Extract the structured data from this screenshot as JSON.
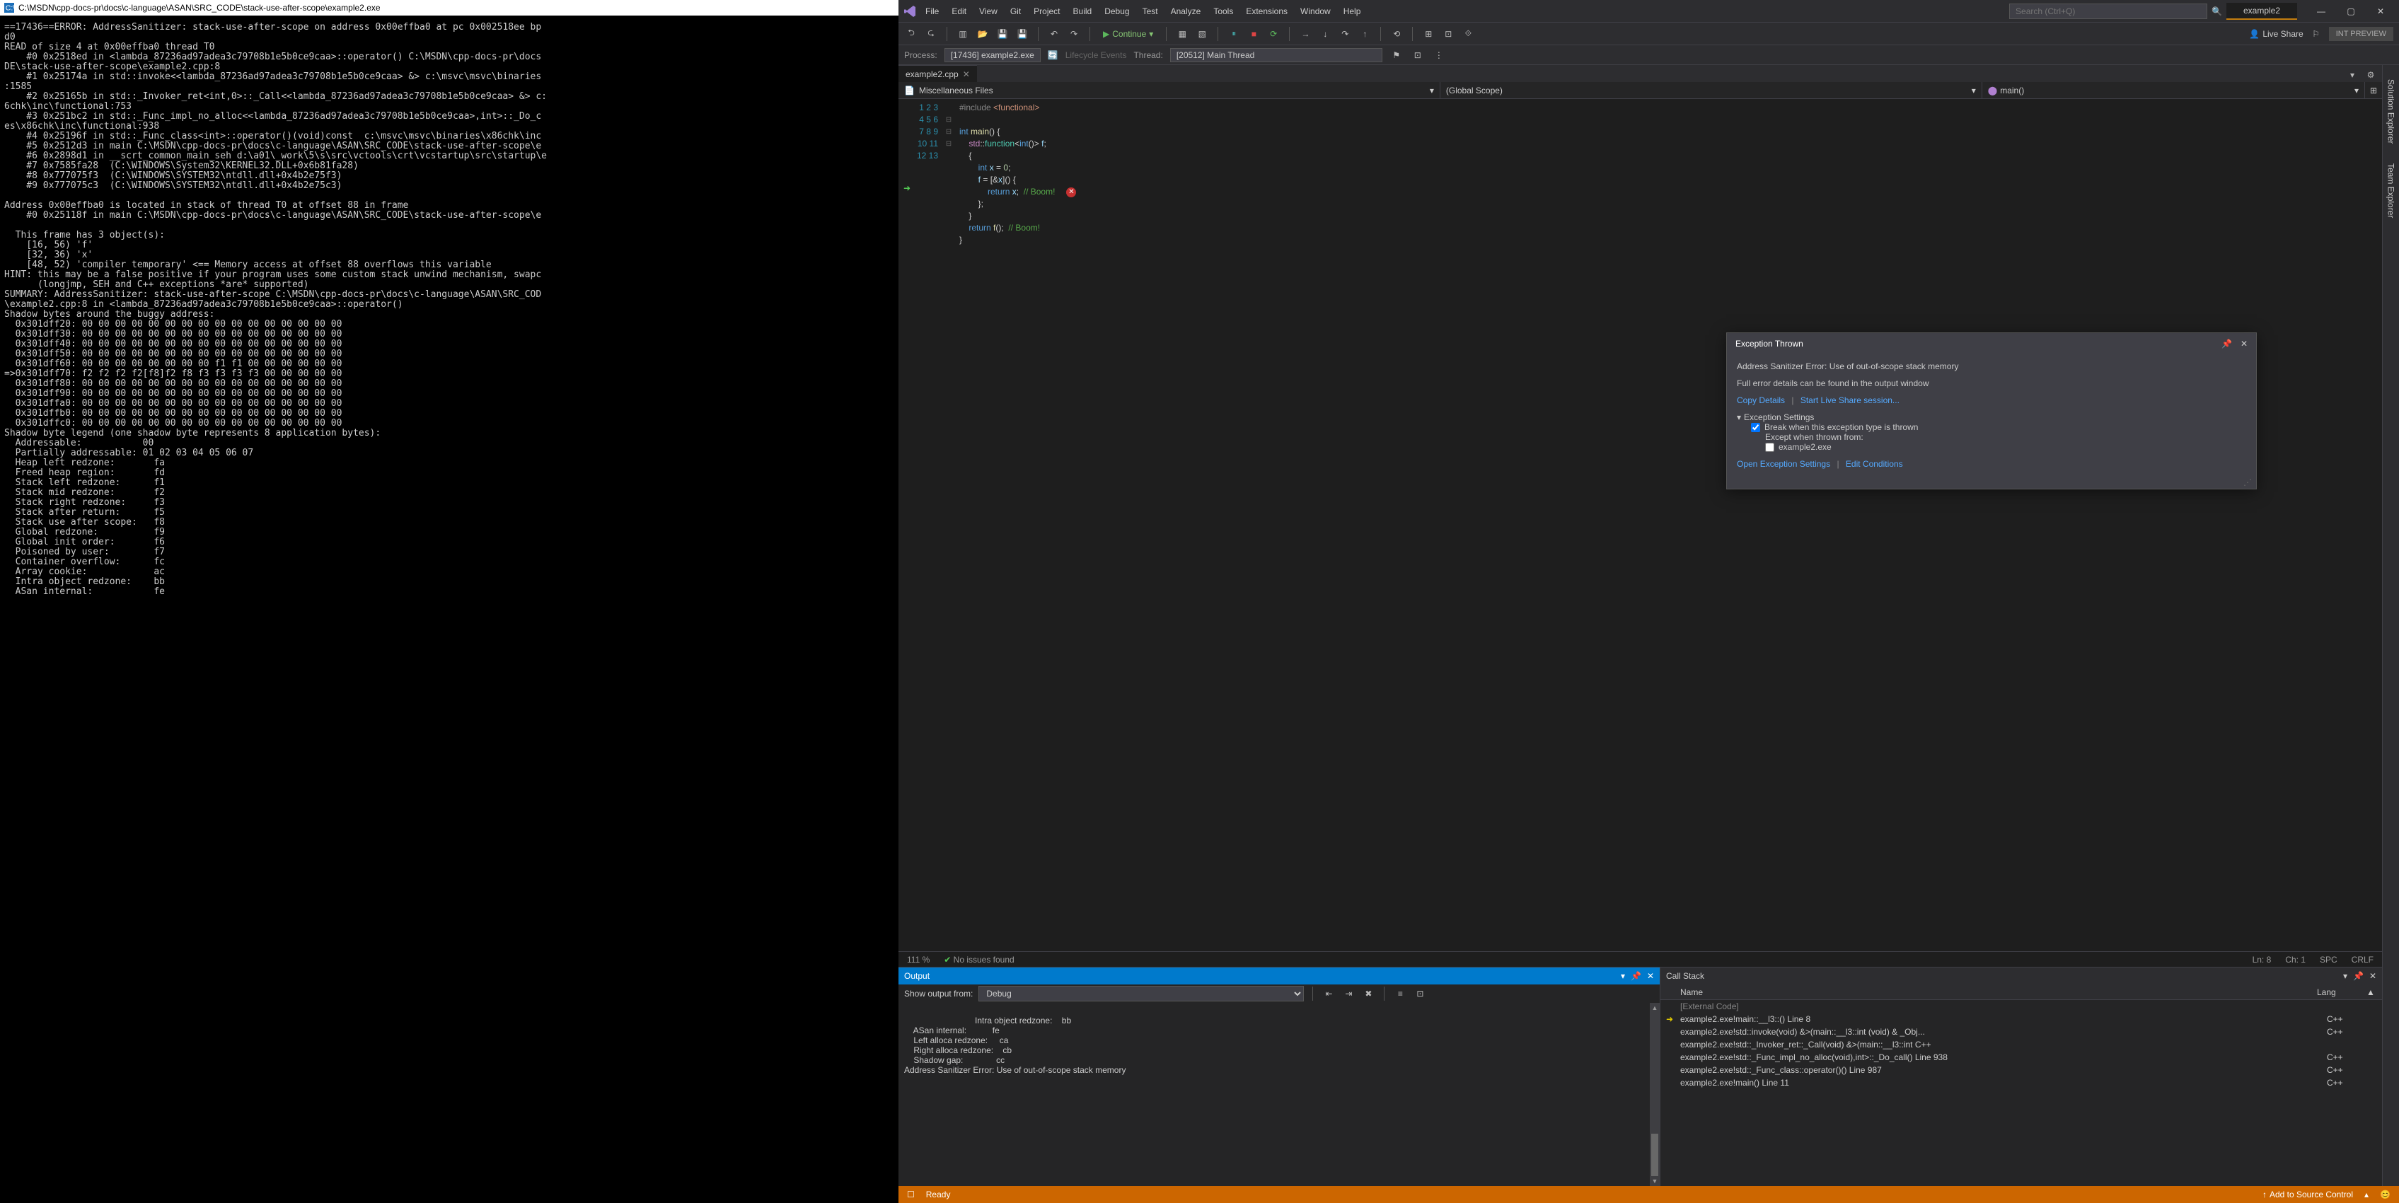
{
  "console": {
    "title": "C:\\MSDN\\cpp-docs-pr\\docs\\c-language\\ASAN\\SRC_CODE\\stack-use-after-scope\\example2.exe",
    "body": "==17436==ERROR: AddressSanitizer: stack-use-after-scope on address 0x00effba0 at pc 0x002518ee bp\nd0\nREAD of size 4 at 0x00effba0 thread T0\n    #0 0x2518ed in <lambda_87236ad97adea3c79708b1e5b0ce9caa>::operator() C:\\MSDN\\cpp-docs-pr\\docs\nDE\\stack-use-after-scope\\example2.cpp:8\n    #1 0x25174a in std::invoke<<lambda_87236ad97adea3c79708b1e5b0ce9caa> &> c:\\msvc\\msvc\\binaries\n:1585\n    #2 0x25165b in std::_Invoker_ret<int,0>::_Call<<lambda_87236ad97adea3c79708b1e5b0ce9caa> &> c:\n6chk\\inc\\functional:753\n    #3 0x251bc2 in std::_Func_impl_no_alloc<<lambda_87236ad97adea3c79708b1e5b0ce9caa>,int>::_Do_c\nes\\x86chk\\inc\\functional:938\n    #4 0x25196f in std::_Func_class<int>::operator()(void)const  c:\\msvc\\msvc\\binaries\\x86chk\\inc\n    #5 0x2512d3 in main C:\\MSDN\\cpp-docs-pr\\docs\\c-language\\ASAN\\SRC_CODE\\stack-use-after-scope\\e\n    #6 0x2898d1 in __scrt_common_main_seh d:\\a01\\_work\\5\\s\\src\\vctools\\crt\\vcstartup\\src\\startup\\e\n    #7 0x7585fa28  (C:\\WINDOWS\\System32\\KERNEL32.DLL+0x6b81fa28)\n    #8 0x777075f3  (C:\\WINDOWS\\SYSTEM32\\ntdll.dll+0x4b2e75f3)\n    #9 0x777075c3  (C:\\WINDOWS\\SYSTEM32\\ntdll.dll+0x4b2e75c3)\n\nAddress 0x00effba0 is located in stack of thread T0 at offset 88 in frame\n    #0 0x25118f in main C:\\MSDN\\cpp-docs-pr\\docs\\c-language\\ASAN\\SRC_CODE\\stack-use-after-scope\\e\n\n  This frame has 3 object(s):\n    [16, 56) 'f'\n    [32, 36) 'x'\n    [48, 52) 'compiler temporary' <== Memory access at offset 88 overflows this variable\nHINT: this may be a false positive if your program uses some custom stack unwind mechanism, swapc\n      (longjmp, SEH and C++ exceptions *are* supported)\nSUMMARY: AddressSanitizer: stack-use-after-scope C:\\MSDN\\cpp-docs-pr\\docs\\c-language\\ASAN\\SRC_COD\n\\example2.cpp:8 in <lambda_87236ad97adea3c79708b1e5b0ce9caa>::operator()\nShadow bytes around the buggy address:\n  0x301dff20: 00 00 00 00 00 00 00 00 00 00 00 00 00 00 00 00\n  0x301dff30: 00 00 00 00 00 00 00 00 00 00 00 00 00 00 00 00\n  0x301dff40: 00 00 00 00 00 00 00 00 00 00 00 00 00 00 00 00\n  0x301dff50: 00 00 00 00 00 00 00 00 00 00 00 00 00 00 00 00\n  0x301dff60: 00 00 00 00 00 00 00 00 f1 f1 00 00 00 00 00 00\n=>0x301dff70: f2 f2 f2 f2[f8]f2 f8 f3 f3 f3 f3 00 00 00 00 00\n  0x301dff80: 00 00 00 00 00 00 00 00 00 00 00 00 00 00 00 00\n  0x301dff90: 00 00 00 00 00 00 00 00 00 00 00 00 00 00 00 00\n  0x301dffa0: 00 00 00 00 00 00 00 00 00 00 00 00 00 00 00 00\n  0x301dffb0: 00 00 00 00 00 00 00 00 00 00 00 00 00 00 00 00\n  0x301dffc0: 00 00 00 00 00 00 00 00 00 00 00 00 00 00 00 00\nShadow byte legend (one shadow byte represents 8 application bytes):\n  Addressable:           00\n  Partially addressable: 01 02 03 04 05 06 07\n  Heap left redzone:       fa\n  Freed heap region:       fd\n  Stack left redzone:      f1\n  Stack mid redzone:       f2\n  Stack right redzone:     f3\n  Stack after return:      f5\n  Stack use after scope:   f8\n  Global redzone:          f9\n  Global init order:       f6\n  Poisoned by user:        f7\n  Container overflow:      fc\n  Array cookie:            ac\n  Intra object redzone:    bb\n  ASan internal:           fe"
  },
  "vs": {
    "menu": [
      "File",
      "Edit",
      "View",
      "Git",
      "Project",
      "Build",
      "Debug",
      "Test",
      "Analyze",
      "Tools",
      "Extensions",
      "Window",
      "Help"
    ],
    "search_placeholder": "Search (Ctrl+Q)",
    "solution_tab": "example2",
    "continue_label": "Continue",
    "liveshare_label": "Live Share",
    "intpreview_label": "INT PREVIEW",
    "process_label": "Process:",
    "process_value": "[17436] example2.exe",
    "lifecycle_label": "Lifecycle Events",
    "thread_label": "Thread:",
    "thread_value": "[20512] Main Thread",
    "editor_tab": "example2.cpp",
    "scope1": "Miscellaneous Files",
    "scope2": "(Global Scope)",
    "scope3": "main()",
    "sidebar_tabs": [
      "Solution Explorer",
      "Team Explorer"
    ],
    "status": {
      "zoom": "111 %",
      "issues": "No issues found",
      "ln": "Ln: 8",
      "ch": "Ch: 1",
      "spc": "SPC",
      "crlf": "CRLF"
    },
    "exception": {
      "title": "Exception Thrown",
      "message": "Address Sanitizer Error: Use of out-of-scope stack memory",
      "sub": "Full error details can be found in the output window",
      "copy": "Copy Details",
      "start_ls": "Start Live Share session...",
      "settings_hdr": "Exception Settings",
      "break_when": "Break when this exception type is thrown",
      "except_from": "Except when thrown from:",
      "module": "example2.exe",
      "open_settings": "Open Exception Settings",
      "edit_cond": "Edit Conditions"
    },
    "output": {
      "title": "Output",
      "show_from": "Show output from:",
      "source": "Debug",
      "body": "    Intra object redzone:    bb\n    ASan internal:           fe\n    Left alloca redzone:     ca\n    Right alloca redzone:    cb\n    Shadow gap:              cc\nAddress Sanitizer Error: Use of out-of-scope stack memory"
    },
    "callstack": {
      "title": "Call Stack",
      "col_name": "Name",
      "col_lang": "Lang",
      "rows": [
        {
          "name": "[External Code]",
          "lang": "",
          "ext": true
        },
        {
          "name": "example2.exe!main::__l3::<lambda>() Line 8",
          "lang": "C++",
          "active": true
        },
        {
          "name": "example2.exe!std::invoke<int <lambda>(void) &>(main::__l3::int <lambda>(void) & _Obj...",
          "lang": "C++"
        },
        {
          "name": "example2.exe!std::_Invoker_ret<int,0>::_Call<int <lambda>(void) &>(main::__l3::int <lam...",
          "lang": "C++"
        },
        {
          "name": "example2.exe!std::_Func_impl_no_alloc<int <lambda>(void),int>::_Do_call() Line 938",
          "lang": "C++"
        },
        {
          "name": "example2.exe!std::_Func_class<int>::operator()() Line 987",
          "lang": "C++"
        },
        {
          "name": "example2.exe!main() Line 11",
          "lang": "C++"
        }
      ]
    },
    "statusbar": {
      "ready": "Ready",
      "add_source": "Add to Source Control"
    }
  }
}
